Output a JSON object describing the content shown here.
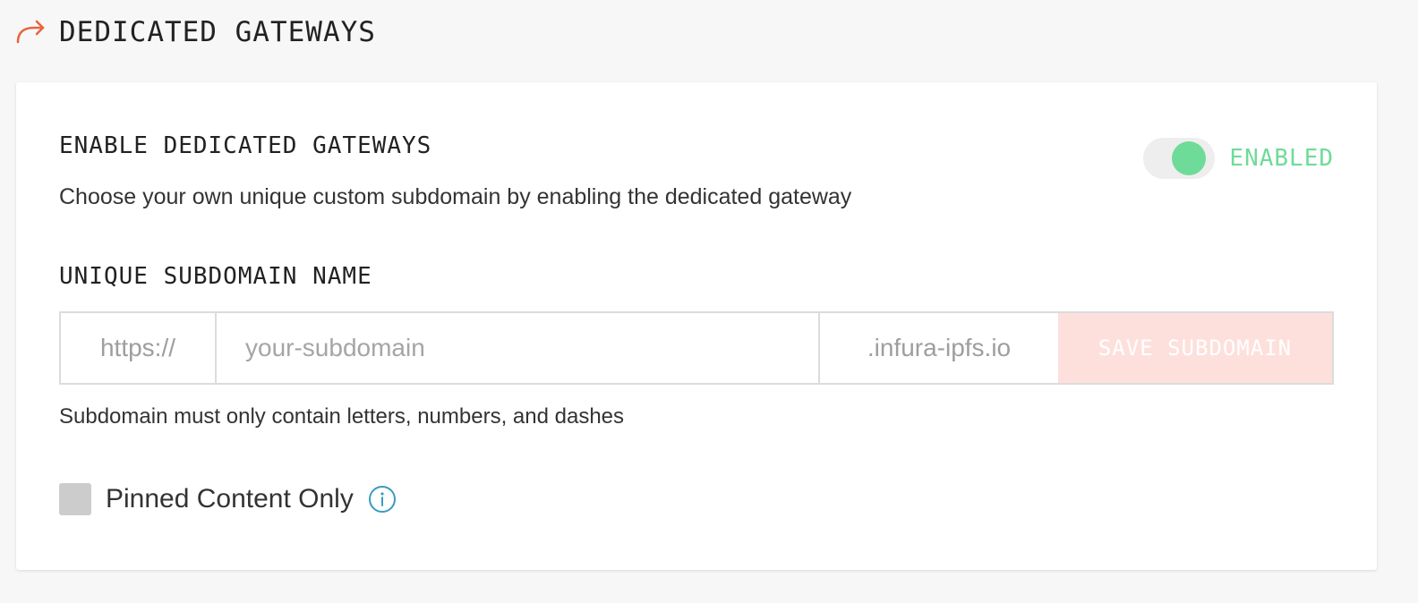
{
  "header": {
    "icon": "share-arrow-icon",
    "title": "DEDICATED GATEWAYS",
    "accent_color": "#e8643c"
  },
  "enable_section": {
    "title": "ENABLE DEDICATED GATEWAYS",
    "description": "Choose your own unique custom subdomain by enabling the dedicated gateway",
    "toggle": {
      "state": "on",
      "label": "ENABLED",
      "color": "#6fdb98"
    }
  },
  "subdomain_section": {
    "title": "UNIQUE SUBDOMAIN NAME",
    "prefix": "https://",
    "input_value": "",
    "input_placeholder": "your-subdomain",
    "suffix": ".infura-ipfs.io",
    "save_label": "SAVE SUBDOMAIN",
    "save_disabled": true,
    "save_color": "#fde0dc",
    "hint": "Subdomain must only contain letters, numbers, and dashes"
  },
  "pinned_option": {
    "label": "Pinned Content Only",
    "checked": false,
    "info_icon": "info-icon",
    "info_color": "#3a9bc1"
  }
}
